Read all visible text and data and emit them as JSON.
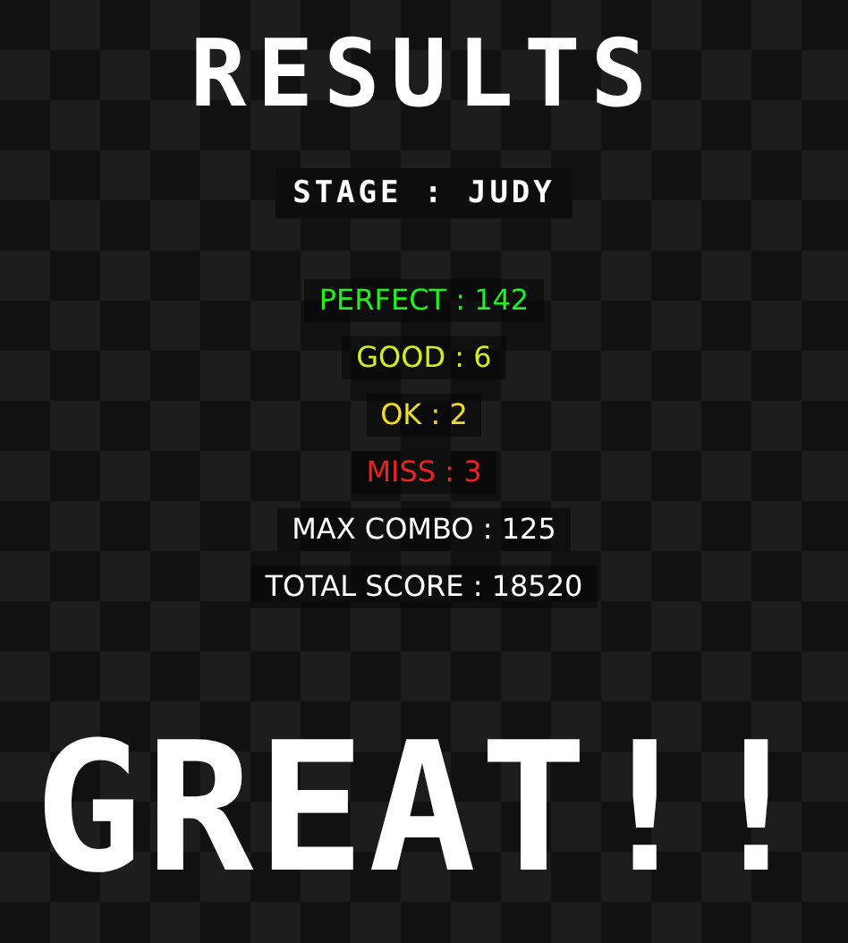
{
  "title": "RESULTS",
  "stage": "STAGE : JUDY",
  "stats": [
    {
      "text": "PERFECT : 142",
      "color": "#22ee22"
    },
    {
      "text": "GOOD : 6",
      "color": "#ccee22"
    },
    {
      "text": "OK : 2",
      "color": "#eedd22"
    },
    {
      "text": "MISS : 3",
      "color": "#ee2222"
    },
    {
      "text": "MAX COMBO : 125",
      "color": "#ffffff"
    },
    {
      "text": "TOTAL SCORE : 18520",
      "color": "#ffffff"
    }
  ],
  "rank": "GREAT!!"
}
